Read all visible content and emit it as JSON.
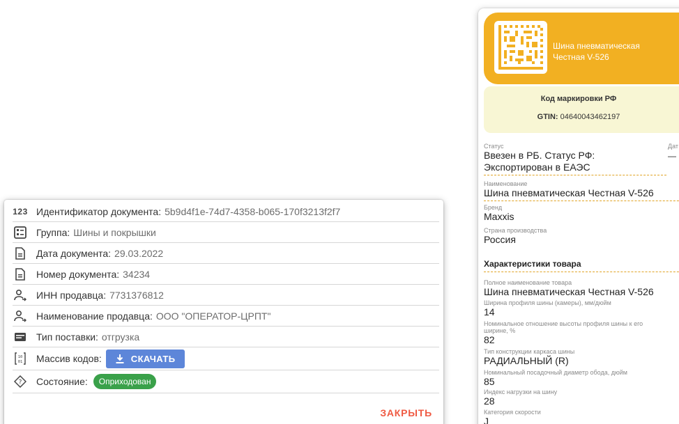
{
  "doc": {
    "rows": [
      {
        "label": "Идентификатор документа:",
        "value": "5b9d4f1e-74d7-4358-b065-170f3213f2f7"
      },
      {
        "label": "Группа:",
        "value": "Шины и покрышки"
      },
      {
        "label": "Дата документа:",
        "value": "29.03.2022"
      },
      {
        "label": "Номер документа:",
        "value": "34234"
      },
      {
        "label": "ИНН продавца:",
        "value": "7731376812"
      },
      {
        "label": "Наименование продавца:",
        "value": "ООО \"ОПЕРАТОР-ЦРПТ\""
      },
      {
        "label": "Тип поставки:",
        "value": "отгрузка"
      },
      {
        "label": "Массив кодов:",
        "value": ""
      },
      {
        "label": "Состояние:",
        "value": ""
      }
    ],
    "id_icon_text": "123",
    "download_label": "СКАЧАТЬ",
    "status_badge": "Оприходован",
    "status_color": "#3aa14a",
    "download_color": "#5d86d9",
    "close_label": "ЗАКРЫТЬ",
    "close_color": "#ef5a43"
  },
  "card": {
    "header_color": "#f2b022",
    "product_name_line1": "Шина пневматическая",
    "product_name_line2": "Честная V-526",
    "mark_title": "Код маркировки РФ",
    "gtin_label": "GTIN:",
    "gtin_value": "04640043462197",
    "status_label": "Статус",
    "status_line1": "Ввезен в РБ. Статус РФ:",
    "status_line2": "Экспортирован в ЕАЭС",
    "date_label": "Дат",
    "date_value": "—",
    "name_label": "Наименование",
    "name_value": "Шина пневматическая Честная V-526",
    "brand_label": "Бренд",
    "brand_value": "Maxxis",
    "country_label": "Страна производства",
    "country_value": "Россия",
    "section_title": "Характеристики товара",
    "full_name_label": "Полное наименование товара",
    "full_name_value": "Шина пневматическая Честная V-526",
    "width_label": "Ширина профиля шины (камеры), мм/дюйм",
    "width_value": "14",
    "ratio_label_1": "Номинальное отношение высоты профиля шины к его",
    "ratio_label_2": "ширине, %",
    "ratio_value": "82",
    "construction_label": "Тип конструкции каркаса шины",
    "construction_value": "РАДИАЛЬНЫЙ (R)",
    "diameter_label": "Номинальный посадочный диаметр обода, дюйм",
    "diameter_value": "85",
    "load_label": "Индекс нагрузки на шину",
    "load_value": "28",
    "speed_label": "Категория скорости",
    "speed_value": "J"
  }
}
